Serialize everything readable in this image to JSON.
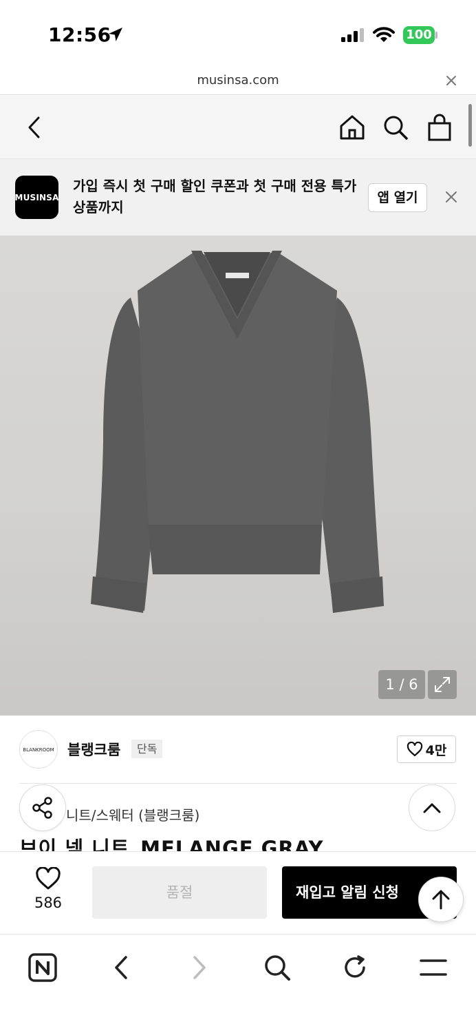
{
  "status_bar": {
    "time": "12:56",
    "battery": "100"
  },
  "browser": {
    "url": "musinsa.com"
  },
  "promo": {
    "logo_text": "MUSINSA",
    "message": "가입 즉시 첫 구매 할인 쿠폰과 첫 구매 전용 특가 상품까지",
    "open_app_label": "앱 열기"
  },
  "gallery": {
    "counter": "1 / 6"
  },
  "brand": {
    "avatar_text": "BLANKROOM",
    "name": "블랭크룸",
    "tag": "단독",
    "likes": "4만"
  },
  "product": {
    "category": "니트/스웨터 (블랭크룸)",
    "title": "브이 넥 니트_MELANGE GRAY"
  },
  "actions": {
    "like_count": "586",
    "soldout_label": "품절",
    "restock_label": "재입고 알림 신청"
  },
  "colors": {
    "battery": "#34c759",
    "primary_button": "#000000",
    "disabled_button": "#eeeeee",
    "sweater": "#5f5f5f"
  }
}
